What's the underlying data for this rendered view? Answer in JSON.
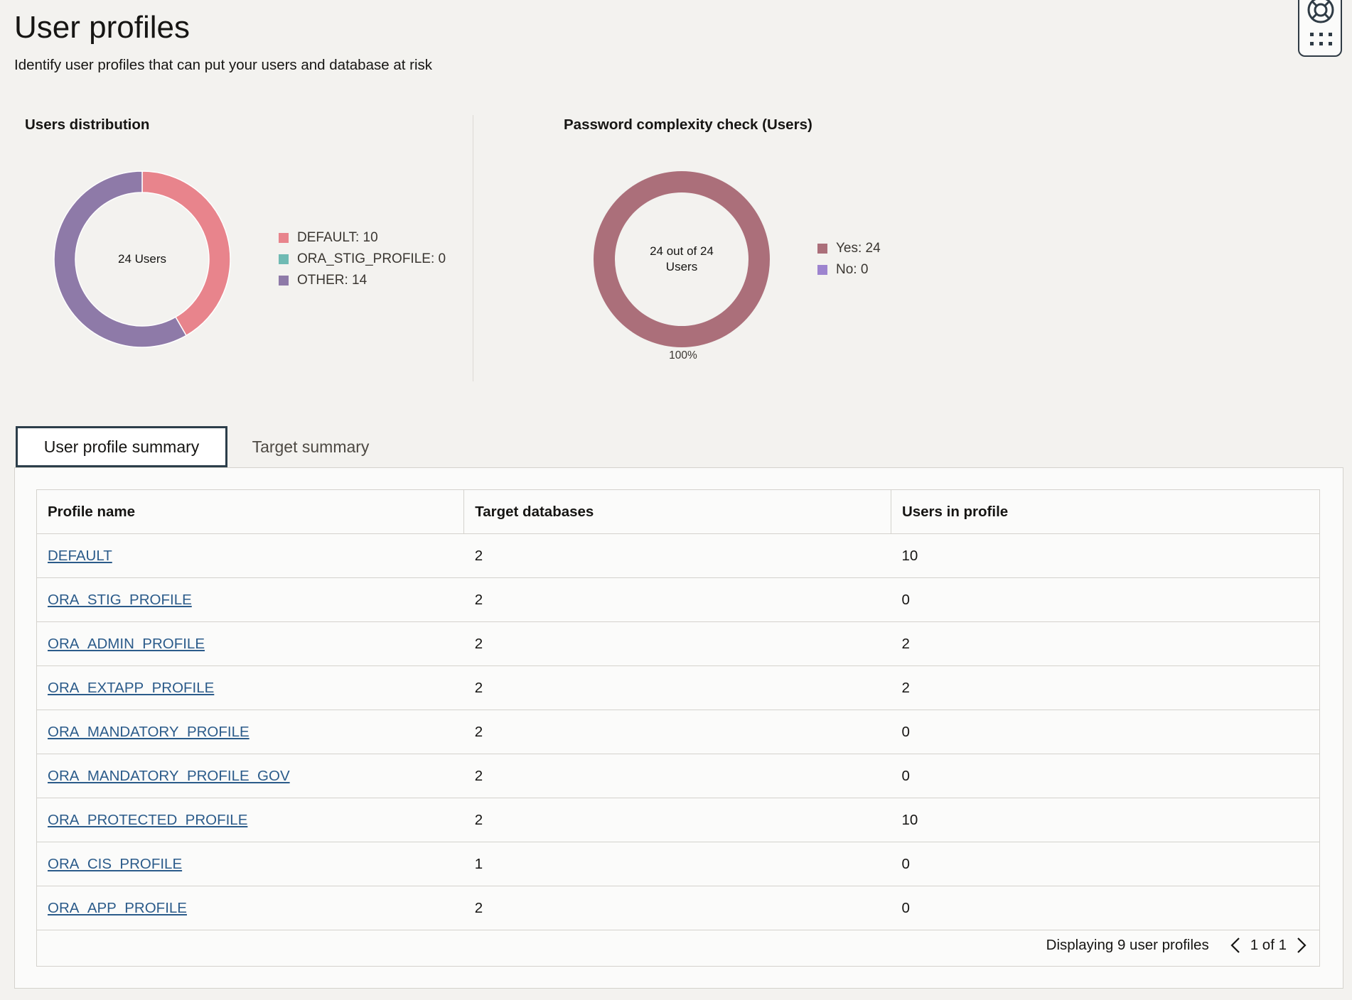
{
  "page": {
    "title": "User profiles",
    "subtitle": "Identify user profiles that can put your users and database at risk"
  },
  "users_distribution": {
    "title": "Users distribution",
    "center_label": "24 Users",
    "legend": [
      {
        "label": "DEFAULT: 10",
        "color": "#e8848c"
      },
      {
        "label": "ORA_STIG_PROFILE: 0",
        "color": "#6fbab3"
      },
      {
        "label": "OTHER: 14",
        "color": "#8e7aa8"
      }
    ]
  },
  "password_check": {
    "title": "Password complexity check (Users)",
    "center_line1": "24 out of 24",
    "center_line2": "Users",
    "percent_label": "100%",
    "legend": [
      {
        "label": "Yes: 24",
        "color": "#ab6f7a"
      },
      {
        "label": "No: 0",
        "color": "#9d84cf"
      }
    ]
  },
  "chart_data": [
    {
      "type": "pie",
      "title": "Users distribution",
      "categories": [
        "DEFAULT",
        "ORA_STIG_PROFILE",
        "OTHER"
      ],
      "values": [
        10,
        0,
        14
      ],
      "colors": [
        "#e8848c",
        "#6fbab3",
        "#8e7aa8"
      ],
      "legend_position": "right"
    },
    {
      "type": "pie",
      "title": "Password complexity check (Users)",
      "categories": [
        "Yes",
        "No"
      ],
      "values": [
        24,
        0
      ],
      "colors": [
        "#ab6f7a",
        "#9d84cf"
      ],
      "legend_position": "right"
    }
  ],
  "tabs": [
    {
      "label": "User profile summary",
      "active": true
    },
    {
      "label": "Target summary",
      "active": false
    }
  ],
  "table": {
    "headers": [
      "Profile name",
      "Target databases",
      "Users in profile"
    ],
    "rows": [
      [
        "DEFAULT",
        "2",
        "10"
      ],
      [
        "ORA_STIG_PROFILE",
        "2",
        "0"
      ],
      [
        "ORA_ADMIN_PROFILE",
        "2",
        "2"
      ],
      [
        "ORA_EXTAPP_PROFILE",
        "2",
        "2"
      ],
      [
        "ORA_MANDATORY_PROFILE",
        "2",
        "0"
      ],
      [
        "ORA_MANDATORY_PROFILE_GOV",
        "2",
        "0"
      ],
      [
        "ORA_PROTECTED_PROFILE",
        "2",
        "10"
      ],
      [
        "ORA_CIS_PROFILE",
        "1",
        "0"
      ],
      [
        "ORA_APP_PROFILE",
        "2",
        "0"
      ]
    ]
  },
  "footer": {
    "count_text": "Displaying 9 user profiles",
    "page_text": "1 of 1"
  },
  "icons": {
    "help": "lifebuoy-icon",
    "apps": "apps-grid-icon",
    "prev": "chevron-left-icon",
    "next": "chevron-right-icon"
  }
}
